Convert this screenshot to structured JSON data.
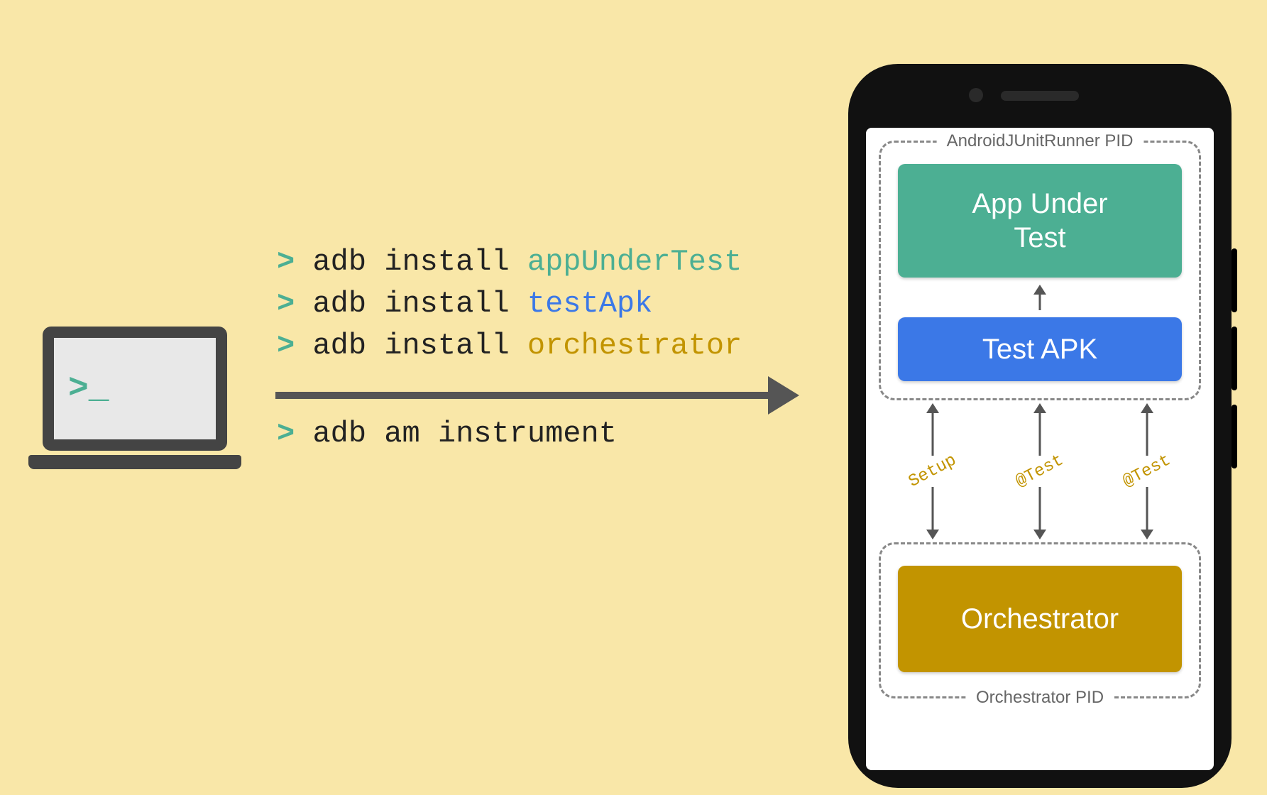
{
  "laptop": {
    "prompt": ">_"
  },
  "commands": [
    {
      "prompt": ">",
      "cmd": "adb install ",
      "arg": "appUnderTest",
      "argClass": "arg-green"
    },
    {
      "prompt": ">",
      "cmd": "adb install ",
      "arg": "testApk",
      "argClass": "arg-blue"
    },
    {
      "prompt": ">",
      "cmd": "adb install ",
      "arg": "orchestrator",
      "argClass": "arg-yellow"
    }
  ],
  "lower_command": {
    "prompt": ">",
    "cmd": "adb am instrument"
  },
  "phone": {
    "top_group_label": "AndroidJUnitRunner PID",
    "bottom_group_label": "Orchestrator PID",
    "app_box": "App Under\nTest",
    "test_apk_box": "Test APK",
    "orchestrator_box": "Orchestrator",
    "between_labels": [
      "Setup",
      "@Test",
      "@Test"
    ]
  },
  "colors": {
    "bg": "#f9e7a8",
    "green": "#4caf93",
    "blue": "#3b78e7",
    "gold": "#c29400",
    "dark": "#444"
  }
}
